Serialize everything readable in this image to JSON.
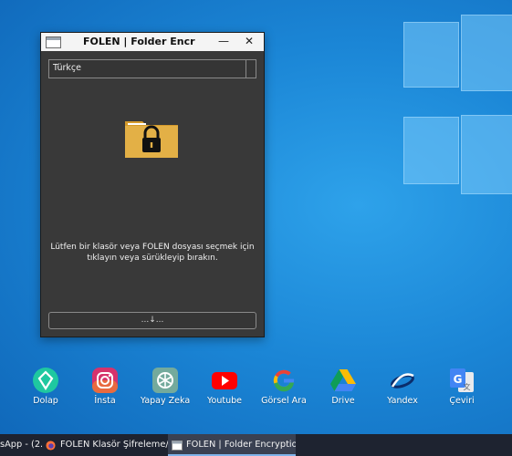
{
  "window": {
    "title": "FOLEN | Folder Encr",
    "minimize_label": "—",
    "close_label": "✕",
    "language": "Türkçe",
    "instructions_line1": "Lütfen bir klasör veya FOLEN dosyası seçmek için",
    "instructions_line2": "tıklayın veya sürükleyip bırakın.",
    "drop_button_label": "...↓..."
  },
  "desktop_icons": [
    {
      "label": "Dolap",
      "icon": "dolap-icon"
    },
    {
      "label": "İnsta",
      "icon": "instagram-icon"
    },
    {
      "label": "Yapay Zeka",
      "icon": "chatgpt-icon"
    },
    {
      "label": "Youtube",
      "icon": "youtube-icon"
    },
    {
      "label": "Görsel Ara",
      "icon": "google-icon"
    },
    {
      "label": "Drive",
      "icon": "google-drive-icon"
    },
    {
      "label": "Yandex",
      "icon": "yandex-icon"
    },
    {
      "label": "Çeviri",
      "icon": "google-translate-icon"
    }
  ],
  "taskbar": {
    "items": [
      {
        "label": "sApp - (2...",
        "icon": "whatsapp-icon"
      },
      {
        "label": "FOLEN Klasör Şifreleme/...",
        "icon": "firefox-icon"
      },
      {
        "label": "FOLEN | Folder Encryption",
        "icon": "folen-app-icon",
        "active": true
      }
    ]
  },
  "colors": {
    "window_bg": "#393939",
    "folder": "#e3b046",
    "desktop_bg": "#1b86d6",
    "taskbar_bg": "#1e2330"
  }
}
